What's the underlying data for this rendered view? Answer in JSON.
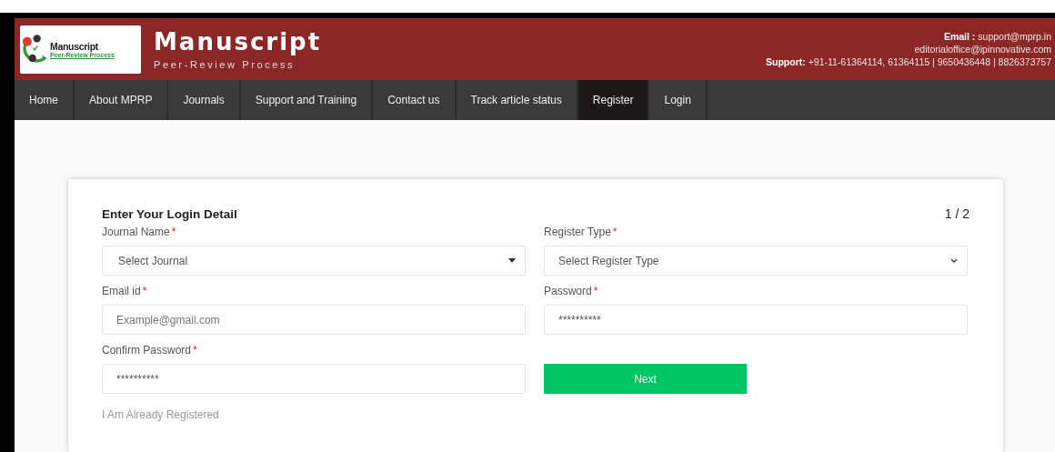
{
  "header": {
    "logo": {
      "name": "Manuscript",
      "tagline": "Peer-Review Process"
    },
    "title": "Manuscript",
    "subtitle": "Peer-Review Process",
    "contact": [
      "**Email :** support@mprp.in",
      "editorialoffice@ipinnovative.com",
      "**Support:** +91-11-61364114, 61364115 | 9650436448 | 8826373757"
    ]
  },
  "nav": [
    {
      "label": "Home",
      "selected": false
    },
    {
      "label": "About MPRP",
      "selected": false
    },
    {
      "label": "Journals",
      "selected": false
    },
    {
      "label": "Support and Training",
      "selected": false
    },
    {
      "label": "Contact us",
      "selected": false
    },
    {
      "label": "Track article status",
      "selected": false
    },
    {
      "label": "Register",
      "selected": true
    },
    {
      "label": "Login",
      "selected": false
    }
  ],
  "form": {
    "title": "Enter Your Login Detail",
    "step": "1 / 2",
    "fields": [
      {
        "kind": "dropdown",
        "label": "Journal Name",
        "required_mark": "*",
        "value": "Select Journal"
      },
      {
        "kind": "select",
        "label": "Register Type",
        "required_mark": "*",
        "value": "Select Register Type"
      },
      {
        "kind": "text",
        "label": "Email id",
        "required_mark": "*",
        "placeholder": "Example@gmail.com"
      },
      {
        "kind": "password",
        "label": "Password",
        "required_mark": "*",
        "value": "**********"
      },
      {
        "kind": "password",
        "label": "Confirm Password",
        "required_mark": "*",
        "value": "**********"
      }
    ],
    "next_button": "Next",
    "login_link": "I Am Already Registered"
  }
}
